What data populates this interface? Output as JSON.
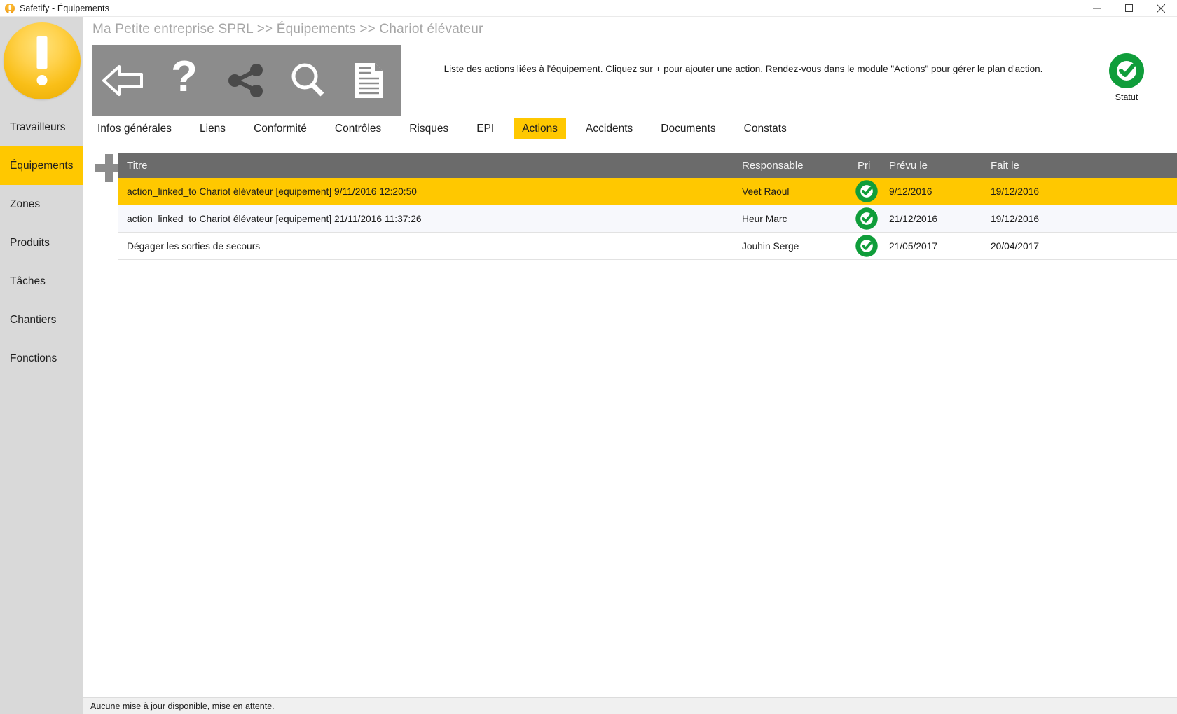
{
  "window": {
    "title": "Safetify - Équipements",
    "app_icon": "safetify-logo-icon",
    "controls": {
      "minimize": "minimize-icon",
      "maximize": "maximize-icon",
      "close": "close-icon"
    }
  },
  "sidebar": {
    "logo": "safetify-exclamation-logo",
    "items": [
      {
        "label": "Travailleurs",
        "active": false
      },
      {
        "label": "Équipements",
        "active": true
      },
      {
        "label": "Zones",
        "active": false
      },
      {
        "label": "Produits",
        "active": false
      },
      {
        "label": "Tâches",
        "active": false
      },
      {
        "label": "Chantiers",
        "active": false
      },
      {
        "label": "Fonctions",
        "active": false
      }
    ]
  },
  "header": {
    "breadcrumb": "Ma Petite entreprise SPRL >> Équipements >> Chariot élévateur",
    "info_text": "Liste des actions liées à l'équipement. Cliquez sur + pour ajouter une action. Rendez-vous dans le module \"Actions\" pour gérer le plan d'action.",
    "statut_label": "Statut",
    "statut_state": "ok"
  },
  "toolbar": {
    "buttons": [
      {
        "icon": "back-arrow-icon",
        "enabled": true
      },
      {
        "icon": "question-mark-icon",
        "enabled": true
      },
      {
        "icon": "share-icon",
        "enabled": false
      },
      {
        "icon": "search-icon",
        "enabled": true
      },
      {
        "icon": "document-icon",
        "enabled": true
      }
    ]
  },
  "tabs": [
    {
      "label": "Infos générales",
      "active": false
    },
    {
      "label": "Liens",
      "active": false
    },
    {
      "label": "Conformité",
      "active": false
    },
    {
      "label": "Contrôles",
      "active": false
    },
    {
      "label": "Risques",
      "active": false
    },
    {
      "label": "EPI",
      "active": false
    },
    {
      "label": "Actions",
      "active": true
    },
    {
      "label": "Accidents",
      "active": false
    },
    {
      "label": "Documents",
      "active": false
    },
    {
      "label": "Constats",
      "active": false
    }
  ],
  "add_button": {
    "icon": "plus-icon",
    "label": ""
  },
  "table": {
    "columns": [
      "Titre",
      "Responsable",
      "Pri",
      "Prévu le",
      "Fait le"
    ],
    "rows": [
      {
        "titre": "action_linked_to Chariot élévateur [equipement]  9/11/2016 12:20:50",
        "responsable": "Veet Raoul",
        "priorite": "ok",
        "prevu_le": "9/12/2016",
        "fait_le": "19/12/2016",
        "selected": true
      },
      {
        "titre": "action_linked_to Chariot élévateur [equipement]  21/11/2016 11:37:26",
        "responsable": "Heur Marc",
        "priorite": "ok",
        "prevu_le": "21/12/2016",
        "fait_le": "19/12/2016",
        "selected": false
      },
      {
        "titre": "Dégager les sorties de secours",
        "responsable": "Jouhin Serge",
        "priorite": "ok",
        "prevu_le": "21/05/2017",
        "fait_le": "20/04/2017",
        "selected": false
      }
    ]
  },
  "statusbar": {
    "message": "Aucune mise à jour disponible, mise en attente."
  },
  "colors": {
    "accent_yellow": "#ffc800",
    "toolbar_gray": "#8c8c8c",
    "header_gray": "#6b6b6b",
    "sidebar_gray": "#d9d9d9",
    "status_green": "#0f9d3a"
  }
}
